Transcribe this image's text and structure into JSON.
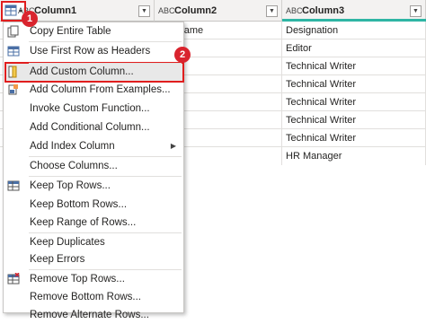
{
  "columns": [
    {
      "type_icon": "ABC",
      "name": "Column1"
    },
    {
      "type_icon": "ABC",
      "name": "Column2"
    },
    {
      "type_icon": "ABC",
      "name": "Column3"
    }
  ],
  "rows": [
    {
      "c2": "yee Name",
      "c3": "Designation"
    },
    {
      "c2": "",
      "c3": "Editor"
    },
    {
      "c2": "",
      "c3": "Technical Writer"
    },
    {
      "c2": "",
      "c3": "Technical Writer"
    },
    {
      "c2": "",
      "c3": "Technical Writer"
    },
    {
      "c2": "",
      "c3": "Technical Writer"
    },
    {
      "c2": "",
      "c3": "Technical Writer"
    },
    {
      "c2": "",
      "c3": "HR Manager"
    }
  ],
  "menu": {
    "items": [
      {
        "label": "Copy Entire Table",
        "icon": "copy-icon"
      },
      {
        "label": "Use First Row as Headers",
        "icon": "table-icon"
      },
      {
        "label": "Add Custom Column...",
        "icon": "add-column-icon"
      },
      {
        "label": "Add Column From Examples...",
        "icon": "examples-icon"
      },
      {
        "label": "Invoke Custom Function..."
      },
      {
        "label": "Add Conditional Column..."
      },
      {
        "label": "Add Index Column"
      },
      {
        "label": "Choose Columns..."
      },
      {
        "label": "Keep Top Rows...",
        "icon": "keep-rows-icon"
      },
      {
        "label": "Keep Bottom Rows..."
      },
      {
        "label": "Keep Range of Rows..."
      },
      {
        "label": "Keep Duplicates"
      },
      {
        "label": "Keep Errors"
      },
      {
        "label": "Remove Top Rows...",
        "icon": "remove-rows-icon"
      },
      {
        "label": "Remove Bottom Rows..."
      },
      {
        "label": "Remove Alternate Rows..."
      }
    ]
  },
  "badges": [
    "1",
    "2"
  ],
  "colors": {
    "accent_red": "#d9242e",
    "quality_bar": "#2eb5a4"
  }
}
